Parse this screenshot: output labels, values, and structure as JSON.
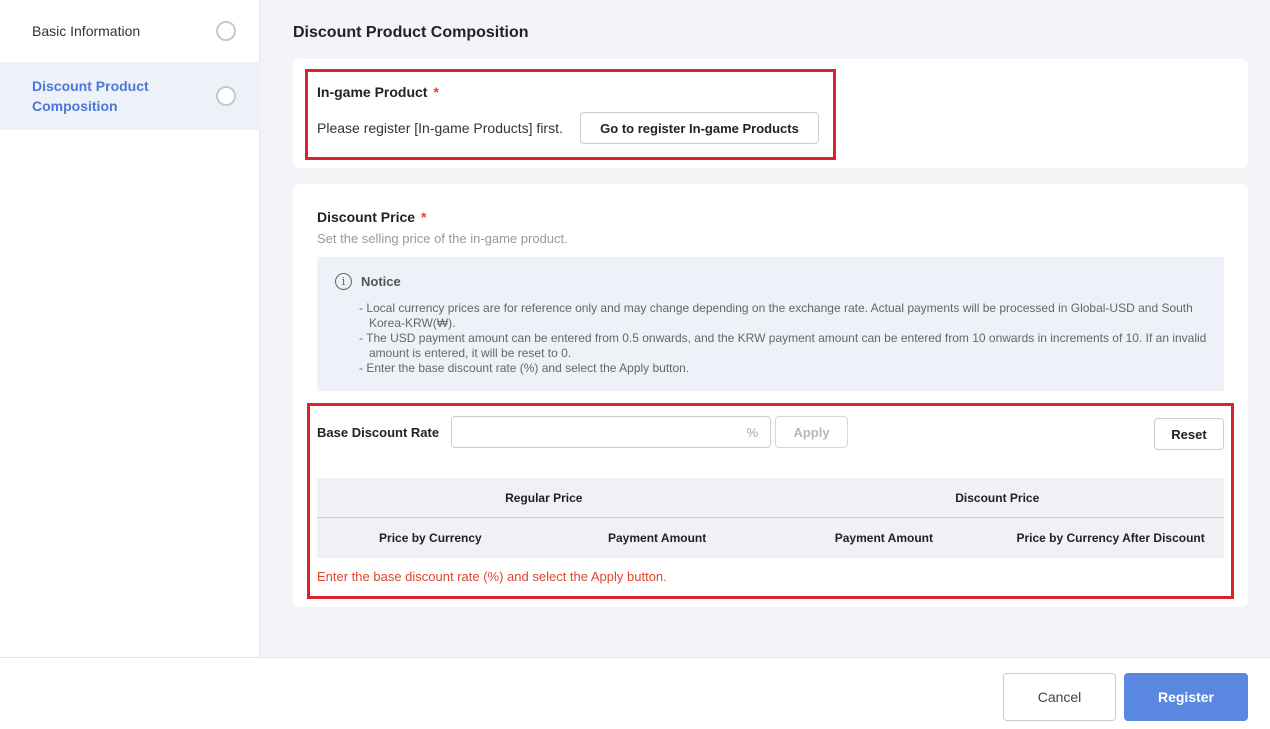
{
  "sidebar": {
    "items": [
      {
        "label": "Basic Information"
      },
      {
        "label": "Discount Product Composition"
      }
    ]
  },
  "main": {
    "title": "Discount Product Composition",
    "ingame": {
      "label": "In-game Product",
      "required": "*",
      "message": "Please register [In-game Products] first.",
      "button": "Go to register In-game Products"
    },
    "discount": {
      "label": "Discount Price",
      "required": "*",
      "description": "Set the selling price of the in-game product.",
      "notice": {
        "title": "Notice",
        "icon": "info-icon",
        "lines": [
          "- Local currency prices are for reference only and may change depending on the exchange rate. Actual payments will be processed in Global-USD and South Korea-KRW(₩).",
          "- The USD payment amount can be entered from 0.5 onwards, and the KRW payment amount can be entered from 10 onwards in increments of 10. If an invalid amount is entered, it will be reset to 0.",
          "- Enter the base discount rate (%) and select the Apply button."
        ]
      },
      "rate": {
        "label": "Base Discount Rate",
        "value": "",
        "suffix": "%",
        "apply": "Apply",
        "reset": "Reset"
      },
      "table": {
        "groups": [
          "Regular Price",
          "Discount Price"
        ],
        "columns": [
          "Price by Currency",
          "Payment Amount",
          "Payment Amount",
          "Price by Currency After Discount"
        ]
      },
      "hint": "Enter the base discount rate (%) and select the Apply button."
    }
  },
  "footer": {
    "cancel": "Cancel",
    "register": "Register"
  },
  "colors": {
    "accent": "#5a87e0",
    "active_sidebar_text": "#4a78d6",
    "required": "#e0452b",
    "highlight_box": "#d9232d"
  }
}
